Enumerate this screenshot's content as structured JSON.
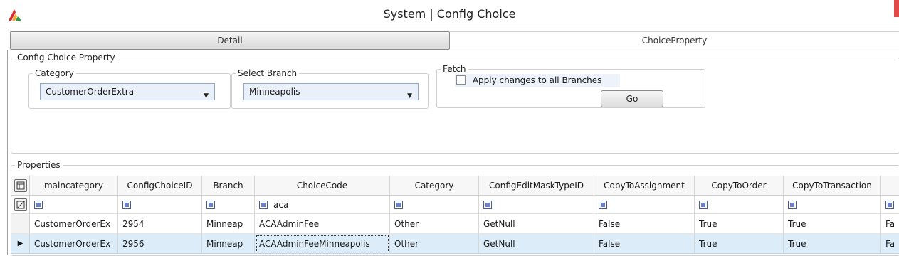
{
  "window": {
    "title": "System | Config Choice"
  },
  "colors": {
    "accent_red": "#e24a4a",
    "selected_row": "#dcedf9",
    "filter_box": "#6c7fd6"
  },
  "tabs": [
    {
      "label": "Detail"
    },
    {
      "label": "ChoiceProperty"
    }
  ],
  "config_group": {
    "legend": "Config Choice Property",
    "category": {
      "label": "Category",
      "value": "CustomerOrderExtra"
    },
    "branch": {
      "label": "Select Branch",
      "value": "Minneapolis"
    },
    "fetch": {
      "label": "Fetch",
      "apply_all_label": "Apply changes to all Branches",
      "apply_all_checked": false,
      "go_label": "Go"
    }
  },
  "properties": {
    "legend": "Properties",
    "columns": [
      "maincategory",
      "ConfigChoiceID",
      "Branch",
      "ChoiceCode",
      "Category",
      "ConfigEditMaskTypeID",
      "CopyToAssignment",
      "CopyToOrder",
      "CopyToTransaction"
    ],
    "filter_values": [
      "",
      "",
      "",
      "aca",
      "",
      "",
      "",
      "",
      "",
      ""
    ],
    "rows": [
      {
        "cells": [
          "CustomerOrderEx",
          "2954",
          "Minneap",
          "ACAAdminFee",
          "Other",
          "GetNull",
          "False",
          "True",
          "True",
          "Fa"
        ],
        "selected": false
      },
      {
        "cells": [
          "CustomerOrderEx",
          "2956",
          "Minneap",
          "ACAAdminFeeMinneapolis",
          "Other",
          "GetNull",
          "False",
          "True",
          "True",
          "Fa"
        ],
        "selected": true
      }
    ]
  }
}
